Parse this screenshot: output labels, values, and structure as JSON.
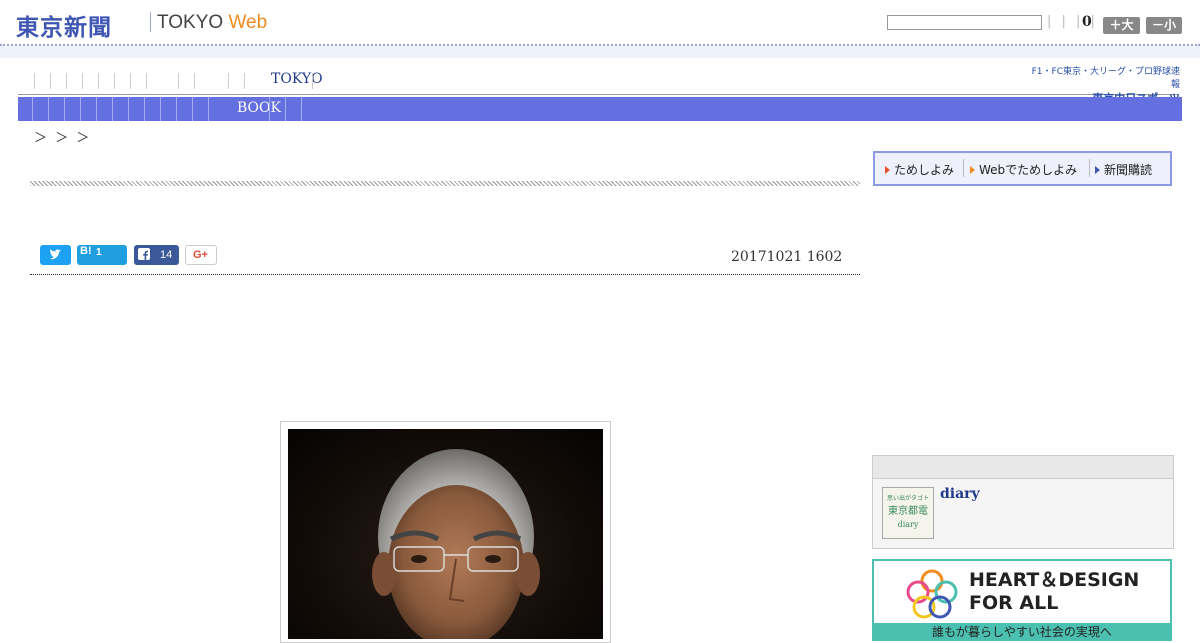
{
  "header": {
    "logo_jp": "東京新聞",
    "logo_tokyo": "TOKYO",
    "logo_web": "Web",
    "links": "| | | |",
    "count": "0",
    "font_large": "＋大",
    "font_small": "－小"
  },
  "nav1": {
    "item": "TOKYO"
  },
  "chunichi": {
    "line1": "F1・FC東京・大リーグ・プロ野球速報",
    "line2": "東京中日スポーツ"
  },
  "nav2": {
    "item": "BOOK"
  },
  "breadcrumb": "＞ ＞ ＞",
  "subscribe": {
    "item1": "ためしよみ",
    "item2": "Webでためしよみ",
    "item3": "新聞購読"
  },
  "social": {
    "twitter_icon": "bird-icon",
    "hatena": "B!",
    "hatena_count": "1",
    "facebook_count": "14",
    "gplus": "G+"
  },
  "article": {
    "date": "20171021 1602"
  },
  "sidebar": {
    "diary_title": "diary",
    "diary_thumb_line1": "思い出がタゴト",
    "diary_thumb_line2": "東京都電",
    "diary_thumb_line3": "diary",
    "banner_line1": "HEART＆DESIGN",
    "banner_line2": "FOR ALL",
    "banner_sub": "誰もが暮らしやすい社会の実現へ"
  },
  "colors": {
    "brand": "#3f56b4",
    "nav_bar": "#6470e0",
    "accent_orange": "#f08c1e",
    "teal": "#4bbfb0"
  }
}
